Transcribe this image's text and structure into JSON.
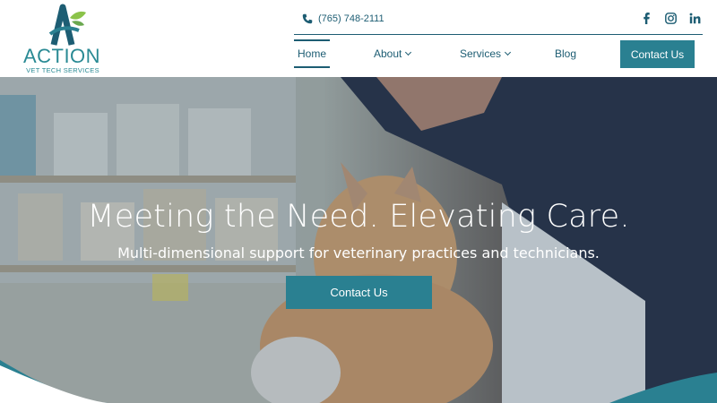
{
  "brand": {
    "name": "ACTION",
    "tagline": "VET TECH SERVICES",
    "colors": {
      "teal": "#2a8091",
      "navy": "#1d5d73",
      "leaf": "#8bc34a"
    }
  },
  "header": {
    "phone": {
      "icon": "phone-icon",
      "text": "(765) 748-2111"
    },
    "socials": [
      {
        "icon": "facebook-icon"
      },
      {
        "icon": "instagram-icon"
      },
      {
        "icon": "linkedin-icon"
      }
    ],
    "nav": {
      "home": "Home",
      "about": "About",
      "services": "Services",
      "blog": "Blog"
    },
    "cta": "Contact Us"
  },
  "hero": {
    "title": "Meeting the Need. Elevating Care.",
    "subtitle": "Multi-dimensional support for veterinary practices and technicians.",
    "cta": "Contact Us"
  }
}
